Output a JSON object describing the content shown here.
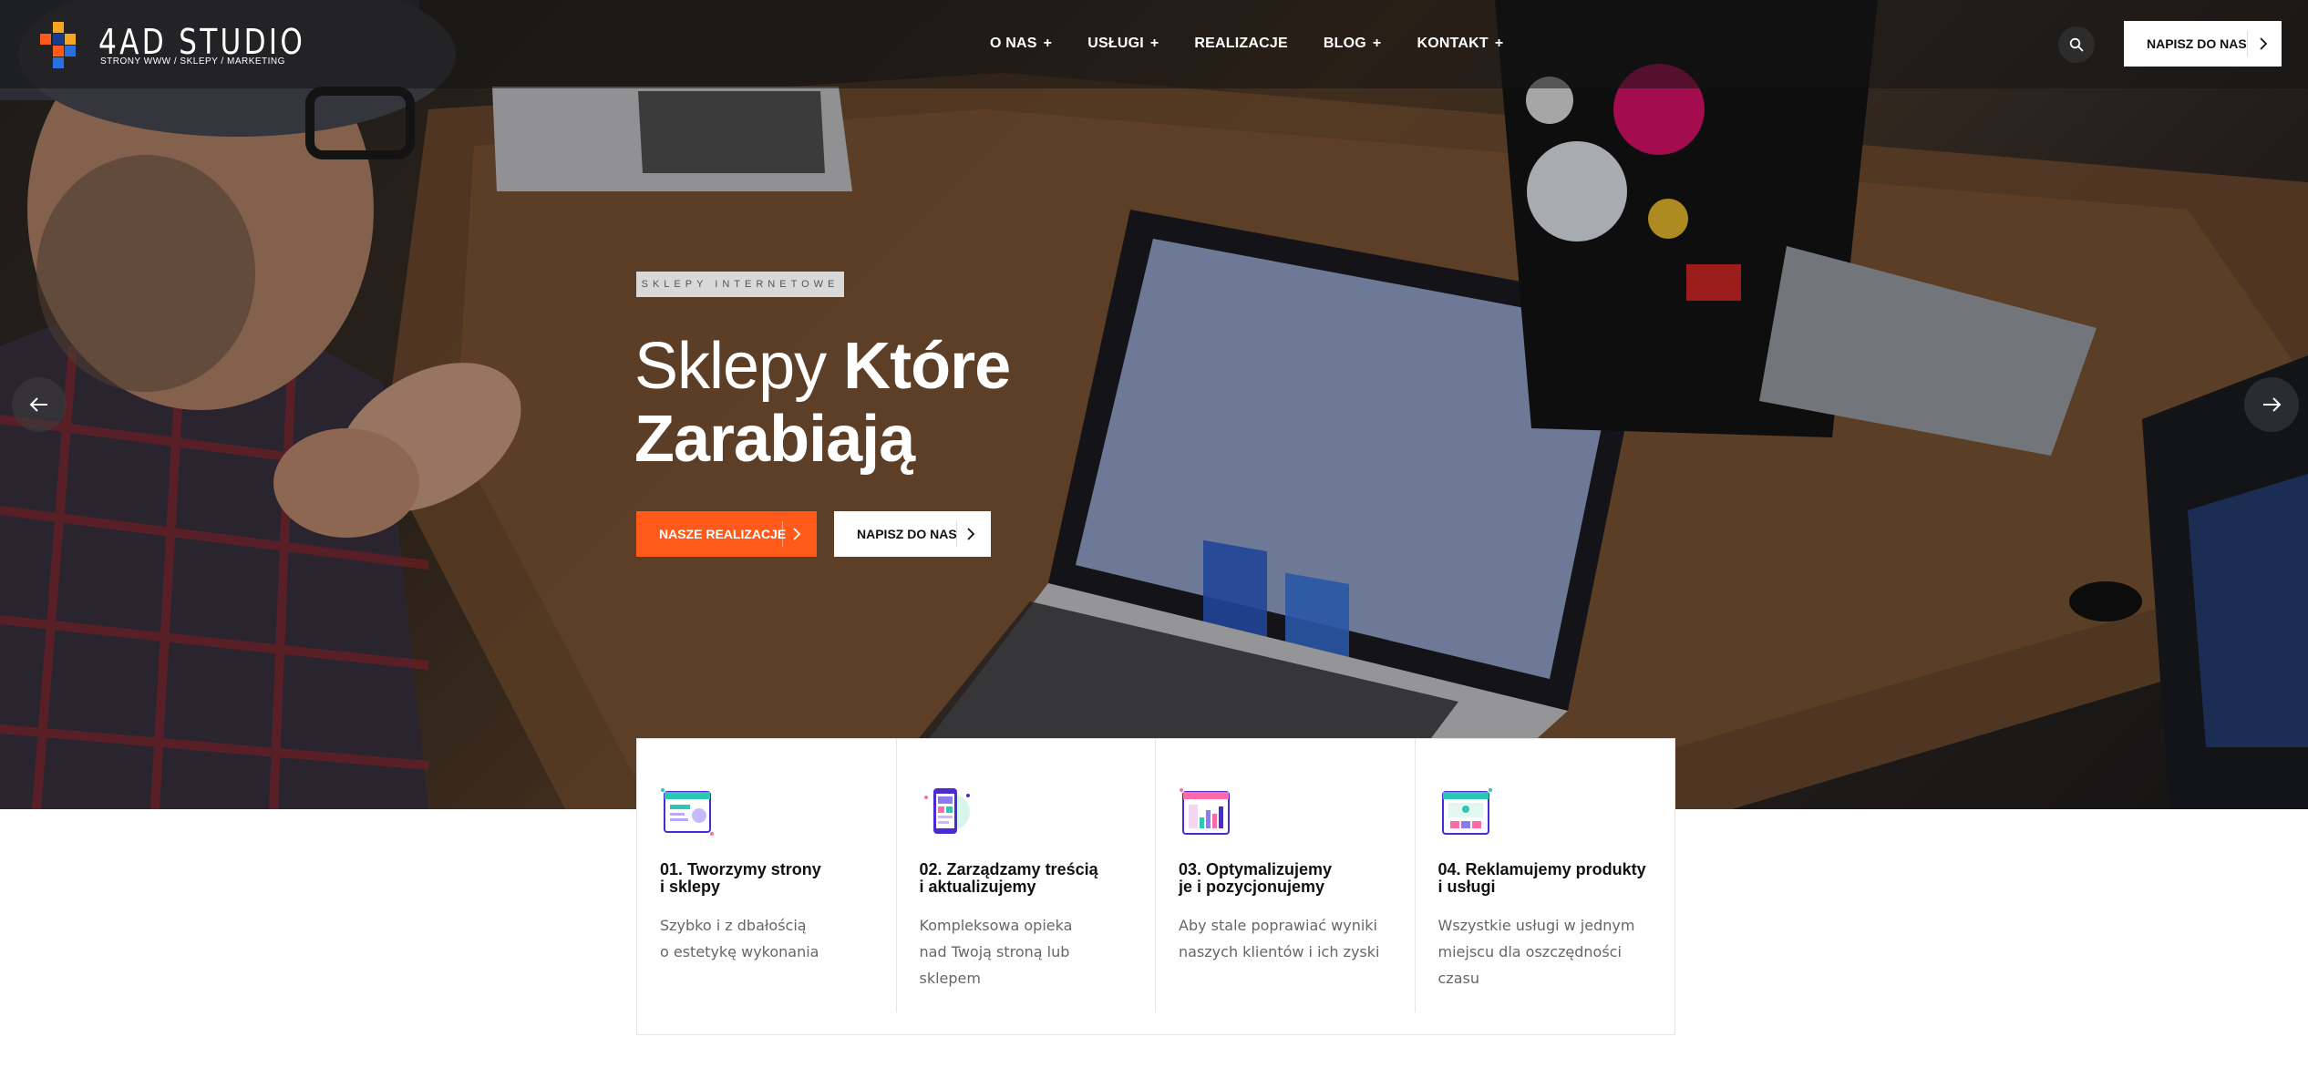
{
  "header": {
    "logo": {
      "title": "4AD STUDIO",
      "subtitle": "STRONY WWW  /  SKLEPY  /  MARKETING",
      "icon": "pixel-blocks-logo",
      "colors": [
        "#ff5a1a",
        "#f5a623",
        "#2a6fdb",
        "#1a3c8c"
      ]
    },
    "nav": [
      {
        "label": "O NAS",
        "has_submenu": true
      },
      {
        "label": "USŁUGI",
        "has_submenu": true
      },
      {
        "label": "REALIZACJE",
        "has_submenu": false
      },
      {
        "label": "BLOG",
        "has_submenu": true
      },
      {
        "label": "KONTAKT",
        "has_submenu": true
      }
    ],
    "submenu_marker": "+",
    "search_icon": "search-icon",
    "cta_label": "NAPISZ DO NAS"
  },
  "hero": {
    "tagline": "SKLEPY INTERNETOWE",
    "headline_light": "Sklepy ",
    "headline_bold_1": "Które",
    "headline_bold_2": "Zarabiają",
    "primary_button": "NASZE REALIZACJE",
    "secondary_button": "NAPISZ DO NAS",
    "prev_icon": "arrow-left-icon",
    "next_icon": "arrow-right-icon",
    "accent_color": "#ff5a1a"
  },
  "features": [
    {
      "title_line1": "01. Tworzymy strony",
      "title_line2": "i sklepy",
      "desc_lines": [
        "Szybko i z dbałością",
        "o estetykę wykonania"
      ],
      "icon": "website-design-icon"
    },
    {
      "title_line1": "02. Zarządzamy treścią",
      "title_line2": "i aktualizujemy",
      "desc_lines": [
        "Kompleksowa opieka",
        "nad Twoją stroną lub",
        "sklepem"
      ],
      "icon": "mobile-content-icon"
    },
    {
      "title_line1": "03. Optymalizujemy",
      "title_line2": "je i pozycjonujemy",
      "desc_lines": [
        "Aby stale poprawiać wyniki",
        "naszych klientów i ich zyski"
      ],
      "icon": "analytics-chart-icon"
    },
    {
      "title_line1": "04. Reklamujemy produkty",
      "title_line2": "i usługi",
      "desc_lines": [
        "Wszystkie usługi w jednym",
        "miejscu dla oszczędności",
        "czasu"
      ],
      "icon": "ad-campaign-icon"
    }
  ]
}
